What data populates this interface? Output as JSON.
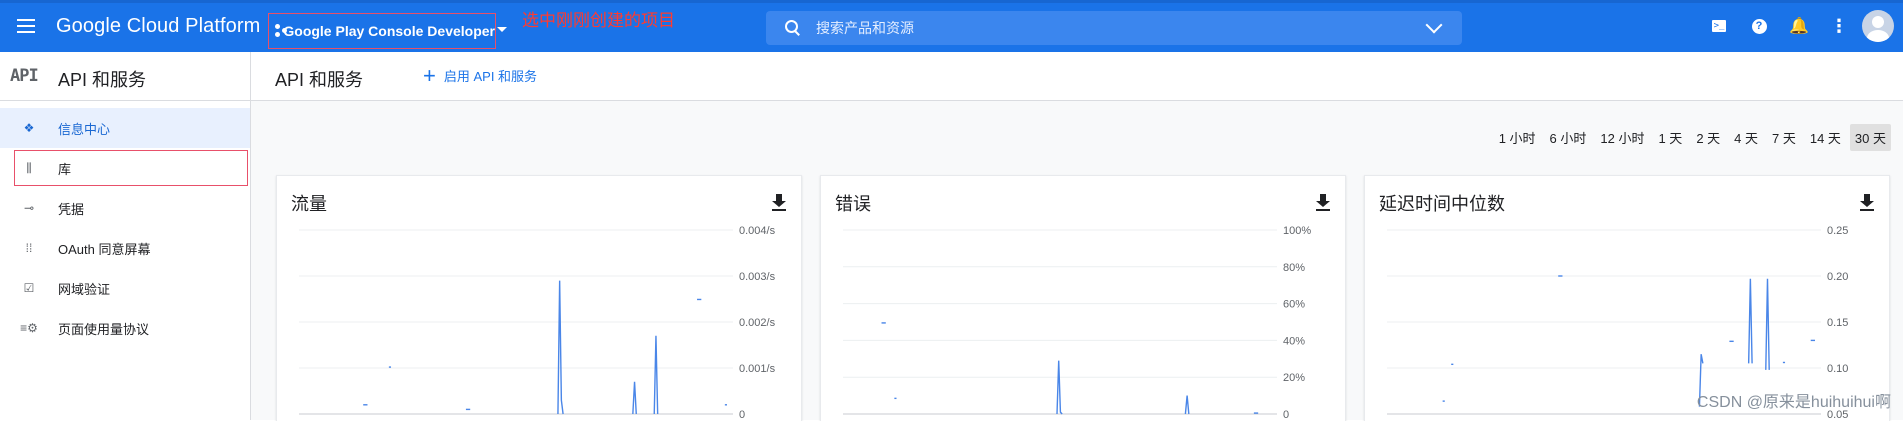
{
  "topbar": {
    "brand": "Google Cloud Platform",
    "project_name": "Google Play Console Developer",
    "annotation": "选中刚刚创建的项目",
    "search_placeholder": "搜索产品和资源",
    "terminal_glyph": ">_",
    "help_glyph": "?",
    "bell_glyph": "🔔",
    "more_glyph": "⋮",
    "colors": {
      "bar": "#1a73e8",
      "annotation": "#ff3b30",
      "highlight_box": "#e8506a"
    }
  },
  "sidebar": {
    "logo": "API",
    "title": "API 和服务",
    "items": [
      {
        "label": "信息中心",
        "icon": "dashboard-diamond-icon",
        "glyph": "❖",
        "active": true
      },
      {
        "label": "库",
        "icon": "library-icon",
        "glyph": "⫼",
        "active": false
      },
      {
        "label": "凭据",
        "icon": "key-icon",
        "glyph": "⊸",
        "active": false
      },
      {
        "label": "OAuth 同意屏幕",
        "icon": "consent-screen-icon",
        "glyph": "⁞⁞",
        "active": false
      },
      {
        "label": "网域验证",
        "icon": "domain-check-icon",
        "glyph": "☑",
        "active": false
      },
      {
        "label": "页面使用量协议",
        "icon": "settings-list-icon",
        "glyph": "≡⚙",
        "active": false
      }
    ]
  },
  "main": {
    "title": "API 和服务",
    "enable_label": "启用 API 和服务",
    "ranges": [
      "1 小时",
      "6 小时",
      "12 小时",
      "1 天",
      "2 天",
      "4 天",
      "7 天",
      "14 天",
      "30 天"
    ],
    "active_range": "30 天"
  },
  "watermark": "CSDN @原来是huihuihui啊",
  "chart_data": [
    {
      "type": "line",
      "title": "流量",
      "y_ticks": [
        "0.004/s",
        "0.003/s",
        "0.002/s",
        "0.001/s",
        "0"
      ],
      "ylim": [
        0,
        0.004
      ],
      "grid": true,
      "color": "#4a86e8",
      "segments": [
        [
          [
            0.15,
            0.0002
          ],
          [
            0.16,
            0.0002
          ]
        ],
        [
          [
            0.21,
            0.00102
          ],
          [
            0.215,
            0.00102
          ]
        ],
        [
          [
            0.39,
            0.0001
          ],
          [
            0.4,
            0.0001
          ]
        ],
        [
          [
            0.93,
            0.00249
          ],
          [
            0.94,
            0.00249
          ]
        ],
        [
          [
            0.995,
            0.0002
          ],
          [
            1.0,
            0.0002
          ]
        ]
      ],
      "spikes": [
        {
          "x": 0.605,
          "points": [
            0.0,
            0.0029,
            0.0003,
            0.0
          ]
        },
        {
          "x": 0.78,
          "points": [
            0.0,
            0.0007,
            0.0
          ]
        },
        {
          "x": 0.83,
          "points": [
            0.0,
            0.0017,
            0.0
          ]
        }
      ]
    },
    {
      "type": "line",
      "title": "错误",
      "y_ticks": [
        "100%",
        "80%",
        "60%",
        "40%",
        "20%",
        "0"
      ],
      "ylim": [
        0,
        100
      ],
      "grid": true,
      "color": "#4a86e8",
      "segments": [
        [
          [
            0.09,
            49.5
          ],
          [
            0.1,
            49.5
          ]
        ],
        [
          [
            0.12,
            8.5
          ],
          [
            0.125,
            8.5
          ]
        ],
        [
          [
            0.96,
            0.5
          ],
          [
            0.97,
            0.5
          ]
        ]
      ],
      "spikes": [
        {
          "x": 0.5,
          "points": [
            0,
            29,
            1,
            0
          ]
        },
        {
          "x": 0.8,
          "points": [
            0,
            10,
            0
          ]
        }
      ]
    },
    {
      "type": "line",
      "title": "延迟时间中位数",
      "y_ticks": [
        "0.25",
        "0.20",
        "0.15",
        "0.10",
        "0.05"
      ],
      "ylim": [
        0.05,
        0.25
      ],
      "grid": true,
      "color": "#4a86e8",
      "segments": [
        [
          [
            0.13,
            0.064
          ],
          [
            0.135,
            0.064
          ]
        ],
        [
          [
            0.15,
            0.104
          ],
          [
            0.155,
            0.104
          ]
        ],
        [
          [
            0.4,
            0.2
          ],
          [
            0.41,
            0.2
          ]
        ],
        [
          [
            0.8,
            0.129
          ],
          [
            0.81,
            0.129
          ]
        ],
        [
          [
            0.925,
            0.106
          ],
          [
            0.93,
            0.106
          ]
        ],
        [
          [
            0.99,
            0.13
          ],
          [
            1.0,
            0.13
          ]
        ]
      ],
      "spikes": [
        {
          "x": 0.73,
          "points": [
            0.058,
            0.115,
            0.105
          ]
        },
        {
          "x": 0.845,
          "points": [
            0.105,
            0.197,
            0.105
          ]
        },
        {
          "x": 0.885,
          "points": [
            0.098,
            0.197,
            0.098
          ]
        }
      ]
    }
  ]
}
